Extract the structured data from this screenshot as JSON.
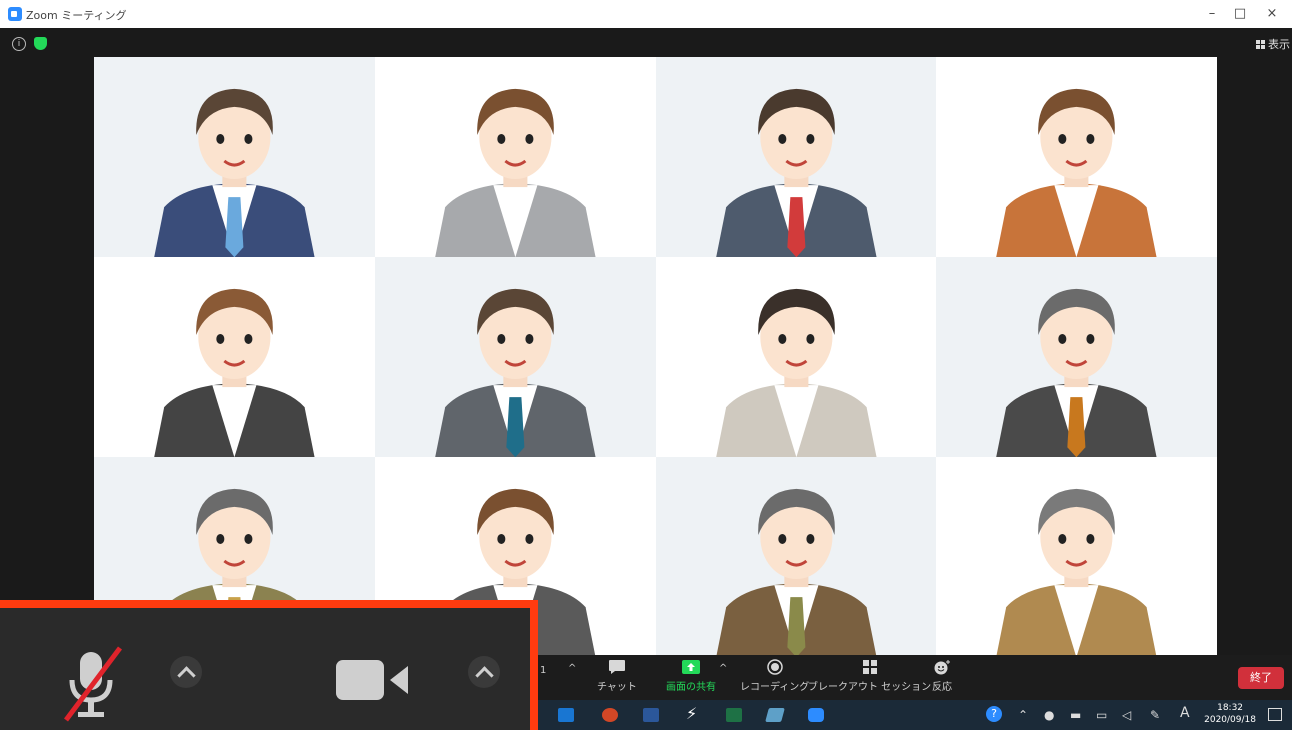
{
  "window": {
    "title": "Zoom ミーティング",
    "minimize": "–",
    "maximize": "□",
    "close": "×"
  },
  "meeting": {
    "view_label": "表示"
  },
  "participants": [
    {
      "hair": "#5a4636",
      "suit": "#3a4d7a",
      "tie": "#6aa9dd",
      "shirt": "#ffffff",
      "bg": "#eef2f5"
    },
    {
      "hair": "#7a5030",
      "suit": "#a7a9ac",
      "tie": null,
      "shirt": "#ffffff",
      "bg": "#ffffff"
    },
    {
      "hair": "#4a3a2e",
      "suit": "#4e5b6d",
      "tie": "#d23b3b",
      "shirt": "#ffffff",
      "bg": "#eef2f5"
    },
    {
      "hair": "#7a5030",
      "suit": "#c8743a",
      "tie": null,
      "shirt": "#ffffff",
      "bg": "#ffffff"
    },
    {
      "hair": "#8a5a36",
      "suit": "#444444",
      "tie": null,
      "shirt": "#ffffff",
      "bg": "#ffffff"
    },
    {
      "hair": "#5a4636",
      "suit": "#60656b",
      "tie": "#1f6e8a",
      "shirt": "#ffffff",
      "bg": "#eef2f5"
    },
    {
      "hair": "#3a302a",
      "suit": "#cfc9bf",
      "tie": null,
      "shirt": "#ffffff",
      "bg": "#ffffff"
    },
    {
      "hair": "#6b6b6b",
      "suit": "#4a4a4a",
      "tie": "#c8781e",
      "shirt": "#ffffff",
      "bg": "#eef2f5"
    },
    {
      "hair": "#6b6b6b",
      "suit": "#8b8250",
      "tie": "#c8a14a",
      "shirt": "#ffffff",
      "bg": "#eef2f5"
    },
    {
      "hair": "#7a5030",
      "suit": "#5a5a5a",
      "tie": null,
      "shirt": "#ffffff",
      "bg": "#ffffff"
    },
    {
      "hair": "#6b6b6b",
      "suit": "#7a6040",
      "tie": "#8a8a4a",
      "shirt": "#ffffff",
      "bg": "#eef2f5"
    },
    {
      "hair": "#7a7a7a",
      "suit": "#b08a50",
      "tie": null,
      "shirt": "#ffffff",
      "bg": "#ffffff"
    }
  ],
  "toolbar": {
    "participants_count": "1",
    "chat": "チャット",
    "share": "画面の共有",
    "record": "レコーディング",
    "breakout": "ブレークアウト セッション",
    "reactions": "反応",
    "end": "終了",
    "caret": "^"
  },
  "taskbar": {
    "ime": "A",
    "time": "18:32",
    "date": "2020/09/18",
    "apps": [
      "outlook-icon",
      "powerpoint-icon",
      "word-icon",
      "lightning-icon",
      "excel-icon",
      "notes-icon",
      "zoom-icon"
    ]
  },
  "colors": {
    "accent": "#2d8cff",
    "end": "#d1303b",
    "highlight": "#ff3b0f",
    "share": "#23d959"
  }
}
